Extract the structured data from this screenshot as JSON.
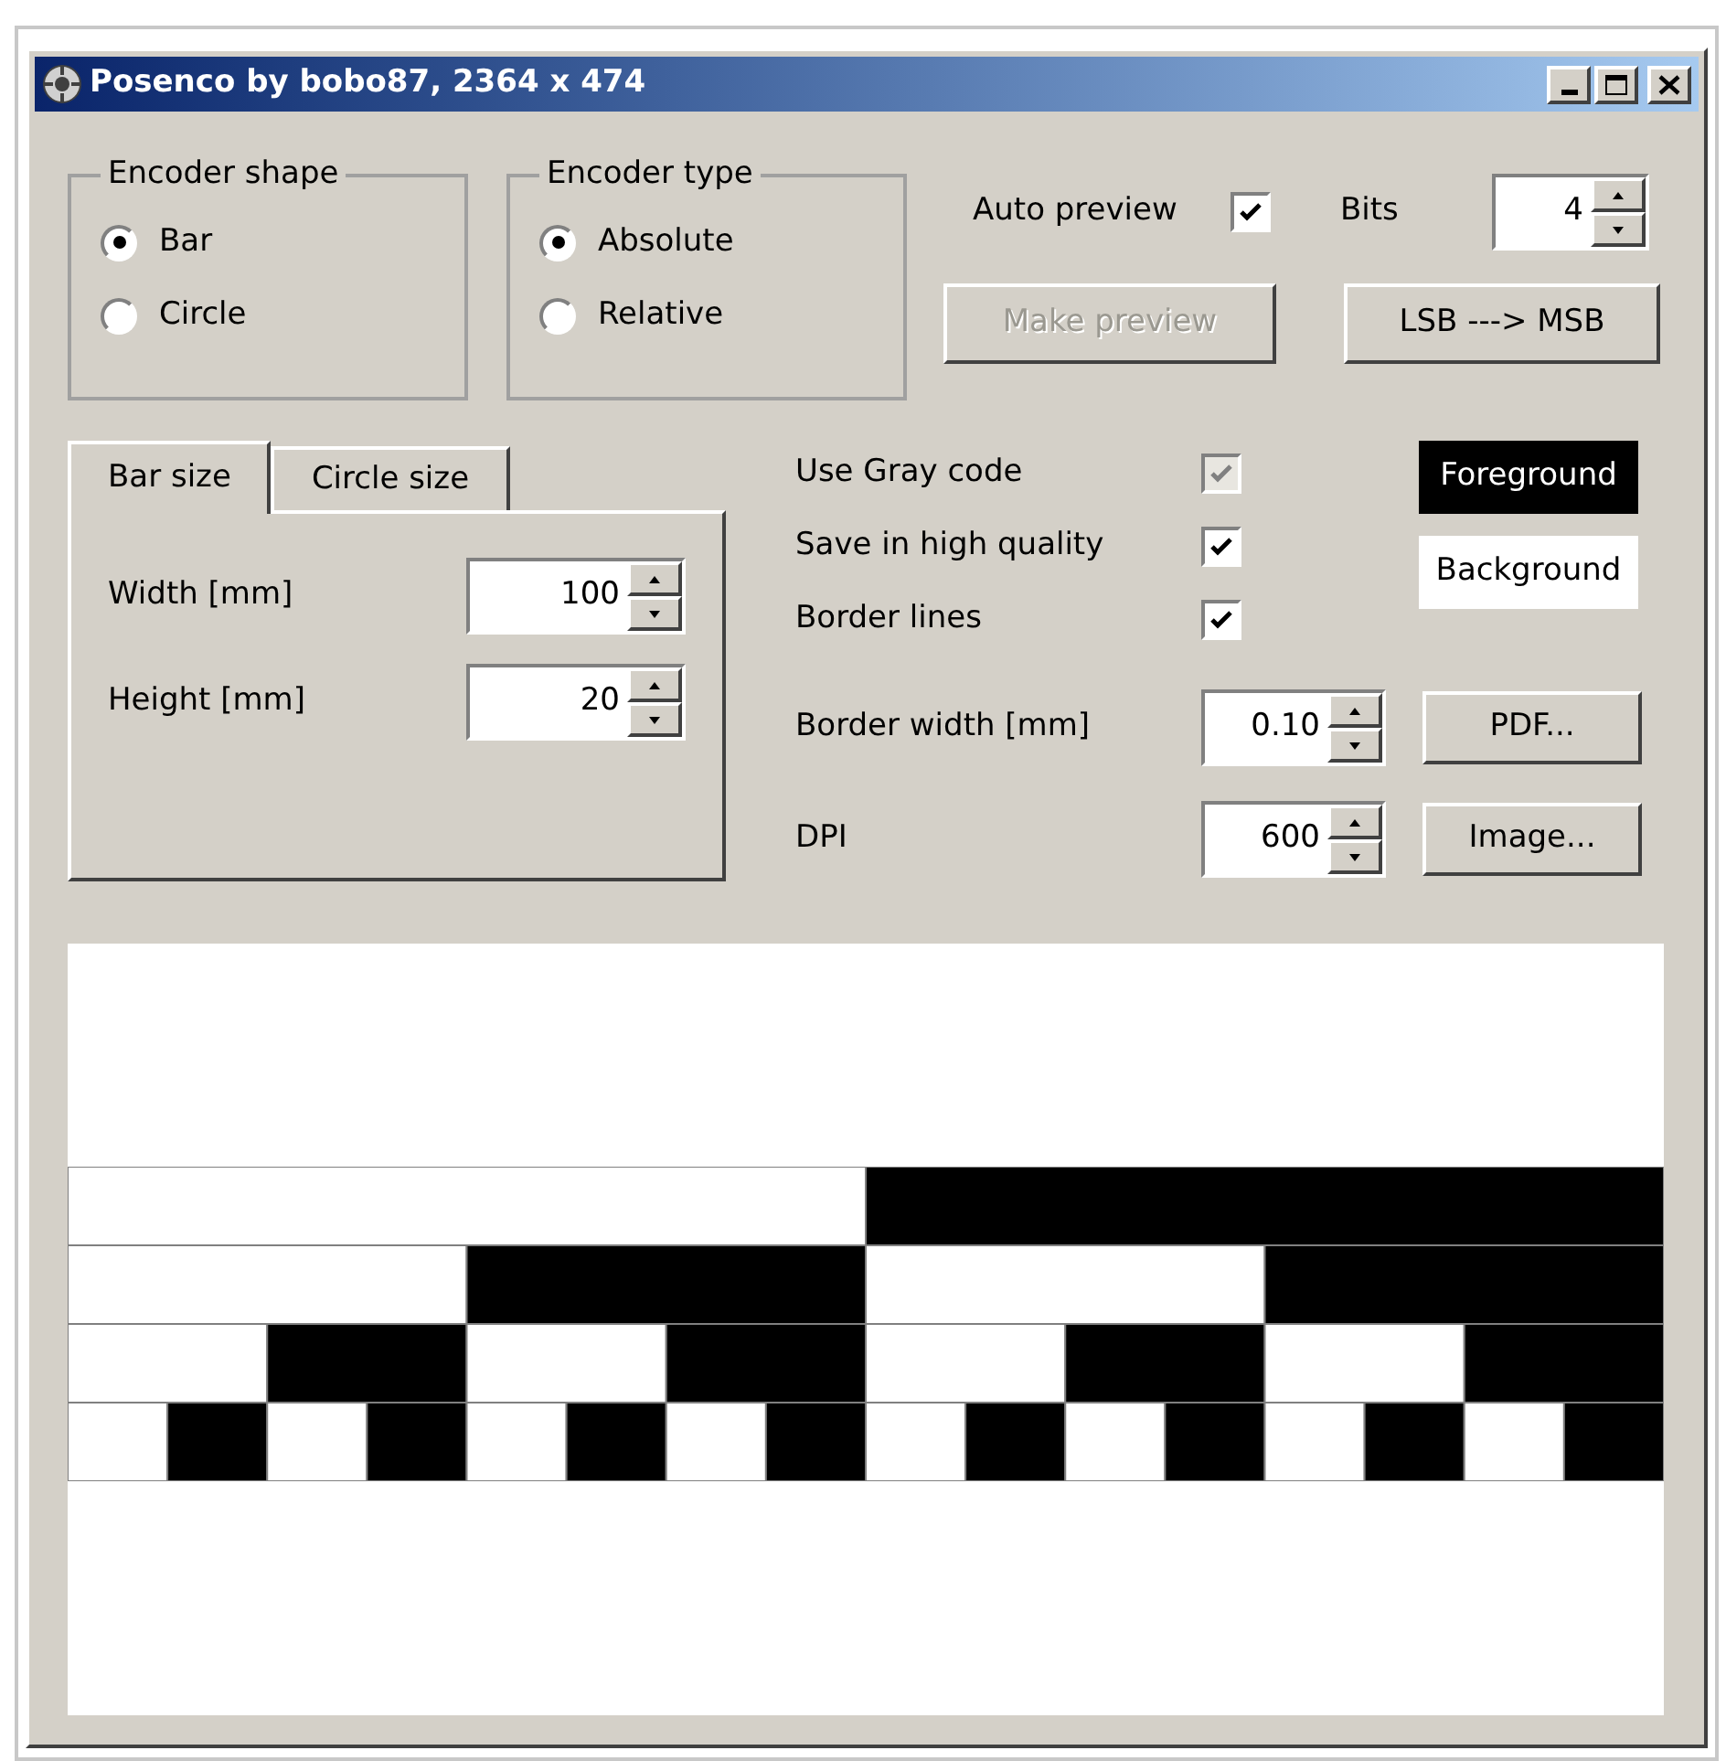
{
  "window": {
    "title": "Posenco by bobo87, 2364 x 474"
  },
  "encoder_shape": {
    "label": "Encoder shape",
    "options": [
      {
        "label": "Bar",
        "selected": true
      },
      {
        "label": "Circle",
        "selected": false
      }
    ]
  },
  "encoder_type": {
    "label": "Encoder type",
    "options": [
      {
        "label": "Absolute",
        "selected": true
      },
      {
        "label": "Relative",
        "selected": false
      }
    ]
  },
  "auto_preview": {
    "label": "Auto preview",
    "checked": true
  },
  "bits": {
    "label": "Bits",
    "value": "4"
  },
  "make_preview": {
    "label": "Make preview",
    "disabled": true
  },
  "order_button": {
    "label": "LSB ---> MSB"
  },
  "size_tabs": [
    {
      "label": "Bar size",
      "selected": true
    },
    {
      "label": "Circle size",
      "selected": false
    }
  ],
  "size_fields": [
    {
      "label": "Width [mm]",
      "value": "100"
    },
    {
      "label": "Height [mm]",
      "value": "20"
    }
  ],
  "options": [
    {
      "label": "Use Gray code",
      "checked": true,
      "disabled": true
    },
    {
      "label": "Save in high quality",
      "checked": true,
      "disabled": false
    },
    {
      "label": "Border lines",
      "checked": true,
      "disabled": false
    }
  ],
  "color_buttons": [
    {
      "label": "Foreground",
      "color": "#000000"
    },
    {
      "label": "Background",
      "color": "#ffffff"
    }
  ],
  "export_rows": [
    {
      "label": "Border width [mm]",
      "value": "0.10",
      "button": "PDF..."
    },
    {
      "label": "DPI",
      "value": "600",
      "button": "Image..."
    }
  ]
}
